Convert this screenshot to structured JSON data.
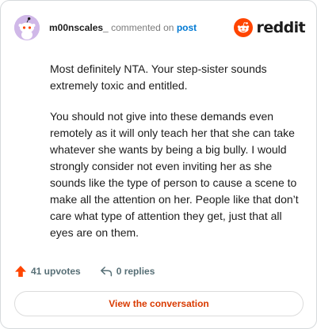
{
  "comment": {
    "username": "m00nscales_",
    "action_text": "commented on",
    "target_link": "post",
    "paragraphs": [
      "Most definitely NTA. Your step-sister sounds extremely toxic and entitled.",
      "You should not give into these demands even remotely as it will only teach her that she can take whatever she wants by being a big bully. I would strongly consider not even inviting her as she sounds like the type of person to cause a scene to make all the attention on her. People like that don’t care what type of attention they get, just that all eyes are on them."
    ]
  },
  "brand": {
    "wordmark": "reddit",
    "icon": "reddit-alien-icon",
    "color": "#ff4500"
  },
  "actions": {
    "upvotes_label": "41 upvotes",
    "replies_label": "0 replies",
    "upvote_icon": "upvote-arrow-icon",
    "reply_icon": "reply-arrow-icon",
    "upvote_color": "#ff4500"
  },
  "cta": {
    "label": "View the conversation",
    "color": "#d93a00"
  },
  "avatar": {
    "background": "#d0b8e8",
    "icon": "snoo-avatar-icon"
  }
}
